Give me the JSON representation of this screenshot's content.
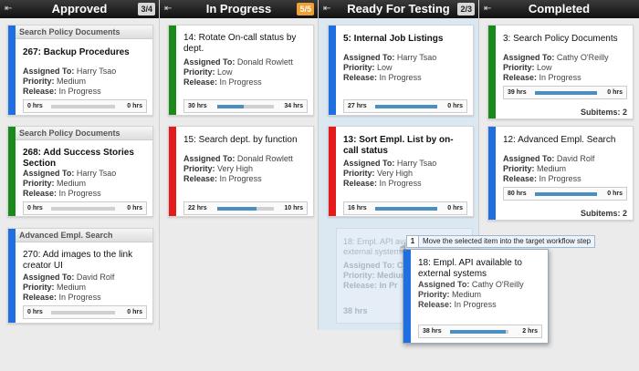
{
  "colors": {
    "green": "#1a8a1a",
    "blue": "#1f6fe0",
    "red": "#e41b1b",
    "progress_fill": "#4a8fc0"
  },
  "labels": {
    "assigned": "Assigned To:",
    "priority": "Priority:",
    "release": "Release:"
  },
  "columns": [
    {
      "title": "Approved",
      "count": "3/4"
    },
    {
      "title": "In Progress",
      "count": "5/5"
    },
    {
      "title": "Ready For Testing",
      "count": "2/3"
    },
    {
      "title": "Completed",
      "count": ""
    }
  ],
  "cards": {
    "c267": {
      "group": "Search Policy Documents",
      "title": "267: Backup Procedures",
      "assigned": "Harry Tsao",
      "priority": "Medium",
      "release": "In Progress",
      "left": "0 hrs",
      "right": "0 hrs",
      "progress": 0
    },
    "c268": {
      "group": "Search Policy Documents",
      "title": "268: Add Success Stories Section",
      "assigned": "Harry Tsao",
      "priority": "Medium",
      "release": "In Progress",
      "left": "0 hrs",
      "right": "0 hrs",
      "progress": 0
    },
    "c270": {
      "group": "Advanced Empl. Search",
      "title": "270: Add images to the link creator UI",
      "assigned": "David Rolf",
      "priority": "Medium",
      "release": "In Progress",
      "left": "0 hrs",
      "right": "0 hrs",
      "progress": 0
    },
    "c14": {
      "title": "14: Rotate On-call status by dept.",
      "assigned": "Donald Rowlett",
      "priority": "Low",
      "release": "In Progress",
      "left": "30 hrs",
      "right": "34 hrs",
      "progress": 0.47
    },
    "c15": {
      "title": "15: Search dept. by function",
      "assigned": "Donald Rowlett",
      "priority": "Very High",
      "release": "In Progress",
      "left": "22 hrs",
      "right": "10 hrs",
      "progress": 0.69
    },
    "c5": {
      "title": "5: Internal Job Listings",
      "assigned": "Harry Tsao",
      "priority": "Low",
      "release": "In Progress",
      "left": "27 hrs",
      "right": "0 hrs",
      "progress": 1
    },
    "c13": {
      "title": "13: Sort Empl. List by on-call status",
      "assigned": "Harry Tsao",
      "priority": "Very High",
      "release": "In Progress",
      "left": "16 hrs",
      "right": "0 hrs",
      "progress": 1
    },
    "c3": {
      "title": "3: Search Policy Documents",
      "assigned": "Cathy O'Reilly",
      "priority": "Low",
      "release": "In Progress",
      "left": "39 hrs",
      "right": "0 hrs",
      "progress": 1,
      "subitems": "Subitems: 2"
    },
    "c12": {
      "title": "12: Advanced Empl. Search",
      "assigned": "David Rolf",
      "priority": "Medium",
      "release": "In Progress",
      "left": "80 hrs",
      "right": "0 hrs",
      "progress": 1,
      "subitems": "Subitems: 2"
    },
    "c18": {
      "title": "18: Empl. API available to external systems",
      "assigned": "Cathy O'Reilly",
      "priority": "Medium",
      "release": "In Progress",
      "left": "38 hrs",
      "right": "2 hrs",
      "progress": 0.95
    }
  },
  "ghost": {
    "title": "18: Empl. API avail",
    "title2": "external systems",
    "assigned": "Assigned To: Ca",
    "priority": "Priority: Medium",
    "release": "Release: In Pr",
    "left": "38 hrs"
  },
  "tooltip": {
    "number": "1",
    "text": "Move the selected item into the target workflow step"
  }
}
